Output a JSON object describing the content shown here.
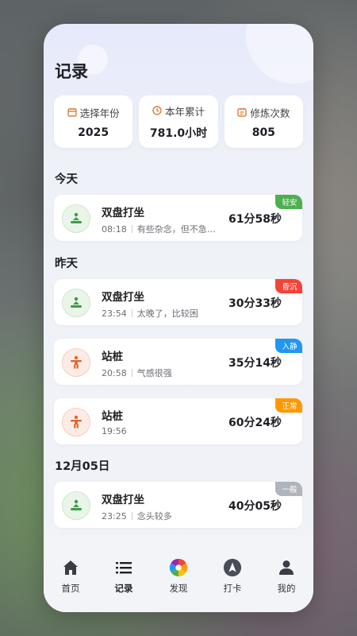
{
  "page": {
    "title": "记录"
  },
  "stats": [
    {
      "label": "选择年份",
      "value": "2025",
      "icon": "calendar-icon"
    },
    {
      "label": "本年累计",
      "value": "781.0小时",
      "icon": "clock-icon"
    },
    {
      "label": "修炼次数",
      "value": "805",
      "icon": "list-calendar-icon"
    }
  ],
  "sections": [
    {
      "title": "今天"
    },
    {
      "title": "昨天"
    },
    {
      "title": "12月05日"
    }
  ],
  "records": [
    {
      "name": "双盘打坐",
      "time": "08:18",
      "note": "有些杂念，但不急…",
      "duration": "61分58秒",
      "tag": "轻安",
      "tag_color": "#4caf50",
      "type": "meditation"
    },
    {
      "name": "双盘打坐",
      "time": "23:54",
      "note": "太晚了，比较困",
      "duration": "30分33秒",
      "tag": "昏沉",
      "tag_color": "#f44336",
      "type": "meditation"
    },
    {
      "name": "站桩",
      "time": "20:58",
      "note": "气感很强",
      "duration": "35分14秒",
      "tag": "入静",
      "tag_color": "#2196f3",
      "type": "standing"
    },
    {
      "name": "站桩",
      "time": "19:56",
      "note": "",
      "duration": "60分24秒",
      "tag": "正常",
      "tag_color": "#ff9800",
      "type": "standing"
    },
    {
      "name": "双盘打坐",
      "time": "23:25",
      "note": "念头较多",
      "duration": "40分05秒",
      "tag": "一般",
      "tag_color": "#b0b4bb",
      "type": "meditation"
    }
  ],
  "nav": [
    {
      "label": "首页",
      "icon": "home-icon",
      "active": false
    },
    {
      "label": "记录",
      "icon": "list-icon",
      "active": true
    },
    {
      "label": "发现",
      "icon": "discover-icon",
      "active": false
    },
    {
      "label": "打卡",
      "icon": "checkin-icon",
      "active": false
    },
    {
      "label": "我的",
      "icon": "profile-icon",
      "active": false
    }
  ]
}
